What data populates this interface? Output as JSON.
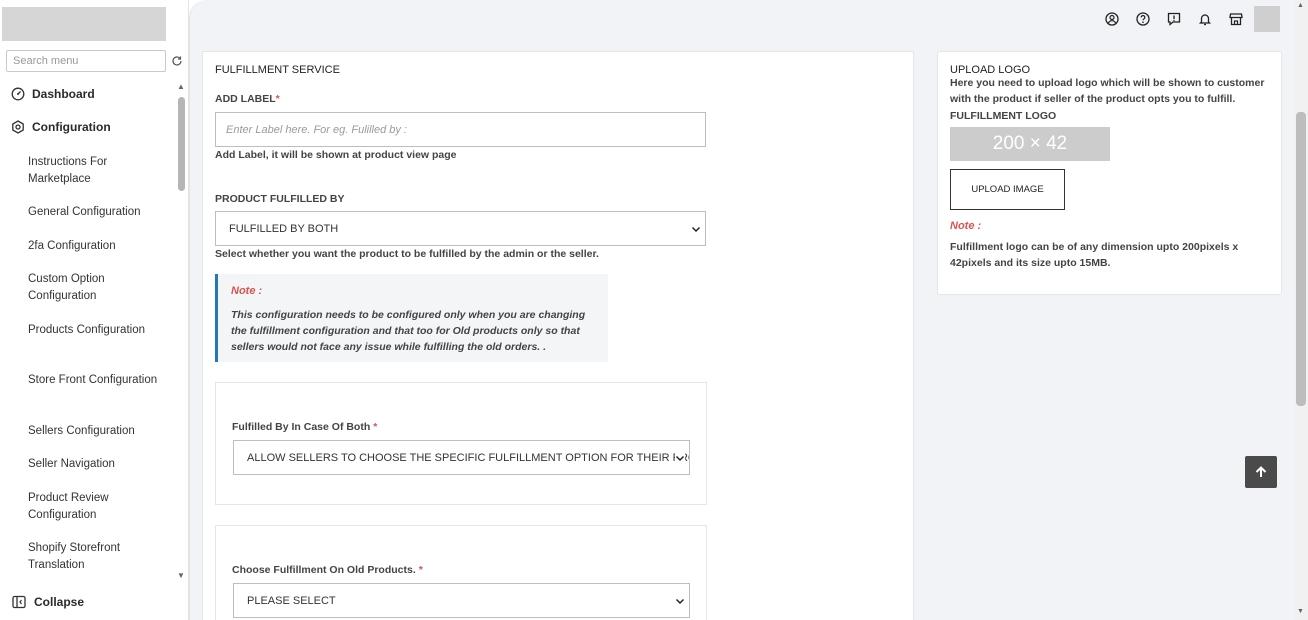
{
  "sidebar": {
    "search_placeholder": "Search menu",
    "items": [
      {
        "label": "Dashboard"
      },
      {
        "label": "Configuration"
      }
    ],
    "sub_items": [
      "Instructions For Marketplace",
      "General Configuration",
      "2fa Configuration",
      "Custom Option Configuration",
      "Products Configuration",
      "Store Front Configuration",
      "Sellers Configuration",
      "Seller Navigation",
      "Product Review Configuration",
      "Shopify Storefront Translation"
    ],
    "collapse_label": "Collapse"
  },
  "topbar": {
    "icons": [
      "user-circle-icon",
      "help-icon",
      "feedback-icon",
      "bell-icon",
      "store-icon"
    ]
  },
  "form": {
    "section_title": "FULFILLMENT SERVICE",
    "add_label": {
      "label": "ADD LABEL",
      "required_mark": "*",
      "placeholder": "Enter Label here. For eg. Fulilled by :",
      "help": "Add Label, it will be shown at product view page"
    },
    "fulfilled_by": {
      "label": "PRODUCT FULFILLED BY",
      "value": "FULFILLED BY BOTH",
      "help": "Select whether you want the product to be fulfilled by the admin or the seller."
    },
    "note": {
      "heading": "Note :",
      "text": "This configuration needs to be configured only when you are changing the fulfillment configuration and that too for Old products only so that sellers would not face any issue while fulfilling the old orders. ."
    },
    "case_both": {
      "label": "Fulfilled By In Case Of Both",
      "required_mark": "*",
      "value": "ALLOW SELLERS TO CHOOSE THE SPECIFIC FULFILLMENT OPTION FOR THEIR PRODUCTS"
    },
    "old_products": {
      "label": "Choose Fulfillment On Old Products.",
      "required_mark": "*",
      "value": "PLEASE SELECT"
    }
  },
  "upload": {
    "title": "UPLOAD LOGO",
    "description": "Here you need to upload logo which will be shown to customer with the product if seller of the product opts you to fulfill.",
    "logo_label": "FULFILLMENT LOGO",
    "placeholder_text": "200 × 42",
    "button_label": "UPLOAD IMAGE",
    "note_heading": "Note :",
    "note_text": "Fulfillment logo can be of any dimension upto 200pixels x 42pixels and its size upto 15MB."
  }
}
